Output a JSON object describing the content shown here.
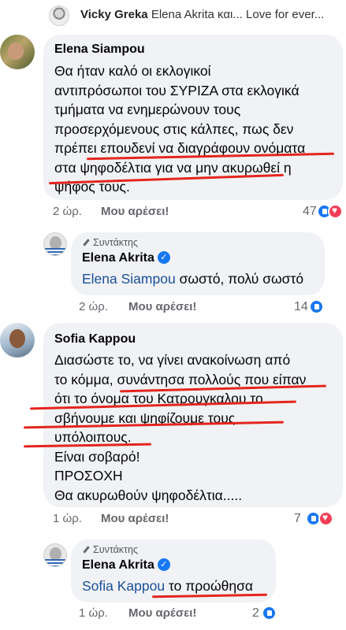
{
  "top_reply": {
    "author": "Vicky Greka",
    "preview": "Elena Akrita και... Love for ever..."
  },
  "comments": [
    {
      "author": "Elena Siampou",
      "lines": [
        "Θα ήταν καλό οι εκλογικοί",
        "αντιπρόσωποι του ΣΥΡΙΖΑ στα εκλογικά",
        "τμήματα να ενημερώνουν τους",
        "προσερχόμενους στις κάλπες, πως δεν",
        "πρέπει επουδενί να διαγράφουν ονόματα",
        "στα ψηφοδέλτια για να μην ακυρωθεί η",
        "ψήφος τους."
      ],
      "time": "2 ώρ.",
      "like": "Μου αρέσει!",
      "reactions": "47",
      "reply": {
        "tag": "Συντάκτης",
        "author": "Elena Akrita",
        "mention": "Elena Siampou",
        "text": " σωστό, πολύ σωστό",
        "time": "2 ώρ.",
        "like": "Μου αρέσει!",
        "reactions": "14"
      }
    },
    {
      "author": "Sofia Kappou",
      "lines": [
        "Διασώστε το, να γίνει ανακοίνωση από",
        "το κόμμα, συνάντησα πολλούς που είπαν",
        "ότι το όνομα του Κατρουγκαλου το",
        "σβήνουμε και ψηφίζουμε τους",
        "υπόλοιπους.",
        "Είναι σοβαρό!",
        "ΠΡΟΣΟΧΗ",
        "Θα ακυρωθούν ψηφοδέλτια....."
      ],
      "time": "1 ώρ.",
      "like": "Μου αρέσει!",
      "reactions": "7",
      "reply": {
        "tag": "Συντάκτης",
        "author": "Elena Akrita",
        "mention": "Sofia Kappou",
        "text": " το προώθησα",
        "time": "1 ώρ.",
        "like": "Μου αρέσει!",
        "reactions": "2"
      }
    }
  ],
  "colors": {
    "bubble": "#f0f2f5",
    "mention": "#1b4f99",
    "underline": "#e4251e",
    "like_blue": "#1877f2",
    "love_red": "#f33e58"
  },
  "icons": [
    "pen-icon",
    "verified-icon",
    "like-reaction-icon",
    "love-reaction-icon"
  ]
}
